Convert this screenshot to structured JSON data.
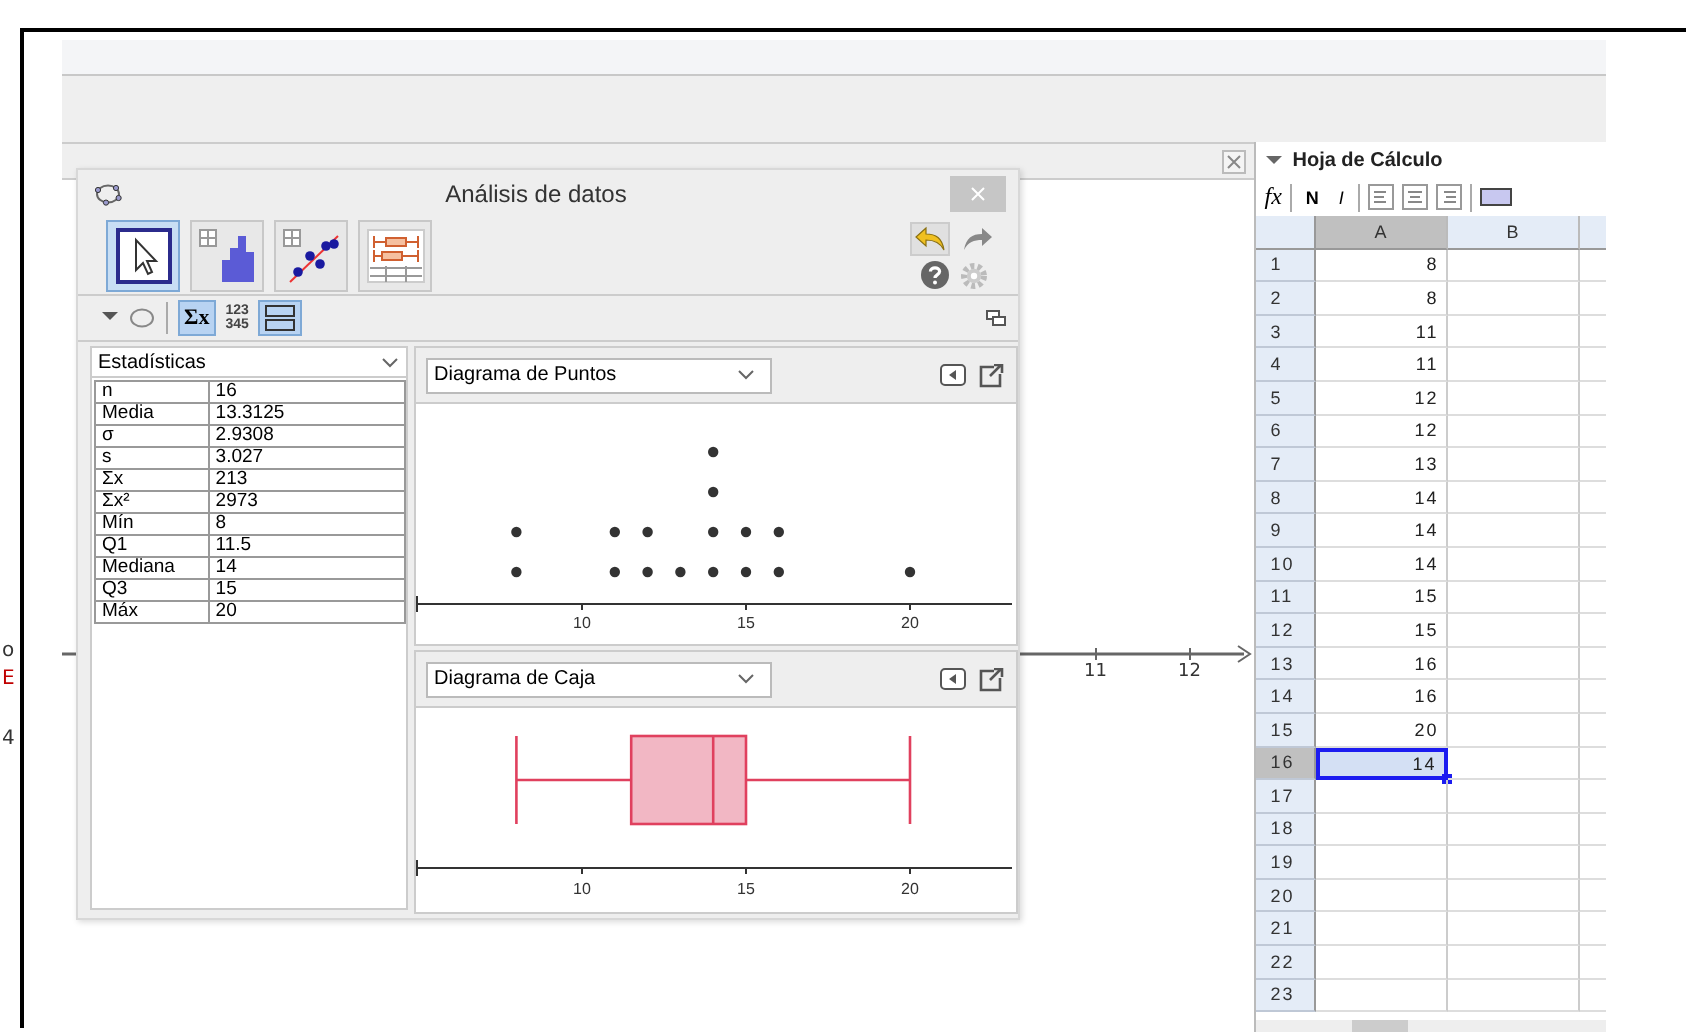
{
  "edge_texts": [
    {
      "text": "o",
      "color": "#333333"
    },
    {
      "text": "E",
      "color": "#c00000"
    },
    {
      "text": "4",
      "color": "#333333"
    }
  ],
  "graphics_view": {
    "axis_labels": [
      "11",
      "12"
    ]
  },
  "dialog": {
    "title": "Análisis de datos",
    "modes": [
      {
        "kind": "pointer",
        "selected": true
      },
      {
        "kind": "histogram",
        "selected": false
      },
      {
        "kind": "scatter",
        "selected": false
      },
      {
        "kind": "boxes",
        "selected": false
      }
    ],
    "sum_button": {
      "label": "Σx",
      "selected": true
    },
    "number_icon": [
      "123",
      "345"
    ],
    "layout_button": {
      "selected": true
    },
    "stats": {
      "dropdown": "Estadísticas",
      "rows": [
        {
          "name": "n",
          "value": "16"
        },
        {
          "name": "Media",
          "value": "13.3125"
        },
        {
          "name": "σ",
          "value": "2.9308"
        },
        {
          "name": "s",
          "value": "3.027"
        },
        {
          "name": "Σx",
          "value": "213"
        },
        {
          "name": "Σx²",
          "value": "2973"
        },
        {
          "name": "Mín",
          "value": "8"
        },
        {
          "name": "Q1",
          "value": "11.5"
        },
        {
          "name": "Mediana",
          "value": "14"
        },
        {
          "name": "Q3",
          "value": "15"
        },
        {
          "name": "Máx",
          "value": "20"
        }
      ]
    },
    "plots": [
      {
        "dropdown": "Diagrama de Puntos",
        "kind": "dots",
        "color": "#333333",
        "axis_labels": [
          "10",
          "15",
          "20"
        ]
      },
      {
        "dropdown": "Diagrama de Caja",
        "kind": "box",
        "color": "#e0405e",
        "axis_labels": [
          "10",
          "15",
          "20"
        ]
      }
    ]
  },
  "spreadsheet": {
    "title": "Hoja de Cálculo",
    "toolbar": {
      "formula": "fx",
      "bold": "N",
      "italic": "I"
    },
    "columns": [
      {
        "label": "A",
        "selected": true
      },
      {
        "label": "B",
        "selected": false
      }
    ],
    "rows": [
      {
        "label": "1",
        "value": "8",
        "selected": false
      },
      {
        "label": "2",
        "value": "8",
        "selected": false
      },
      {
        "label": "3",
        "value": "11",
        "selected": false
      },
      {
        "label": "4",
        "value": "11",
        "selected": false
      },
      {
        "label": "5",
        "value": "12",
        "selected": false
      },
      {
        "label": "6",
        "value": "12",
        "selected": false
      },
      {
        "label": "7",
        "value": "13",
        "selected": false
      },
      {
        "label": "8",
        "value": "14",
        "selected": false
      },
      {
        "label": "9",
        "value": "14",
        "selected": false
      },
      {
        "label": "10",
        "value": "14",
        "selected": false
      },
      {
        "label": "11",
        "value": "15",
        "selected": false
      },
      {
        "label": "12",
        "value": "15",
        "selected": false
      },
      {
        "label": "13",
        "value": "16",
        "selected": false
      },
      {
        "label": "14",
        "value": "16",
        "selected": false
      },
      {
        "label": "15",
        "value": "20",
        "selected": false
      },
      {
        "label": "16",
        "value": "14",
        "selected": true
      },
      {
        "label": "17",
        "value": "",
        "selected": false
      },
      {
        "label": "18",
        "value": "",
        "selected": false
      },
      {
        "label": "19",
        "value": "",
        "selected": false
      },
      {
        "label": "20",
        "value": "",
        "selected": false
      },
      {
        "label": "21",
        "value": "",
        "selected": false
      },
      {
        "label": "22",
        "value": "",
        "selected": false
      },
      {
        "label": "23",
        "value": "",
        "selected": false
      }
    ]
  }
}
